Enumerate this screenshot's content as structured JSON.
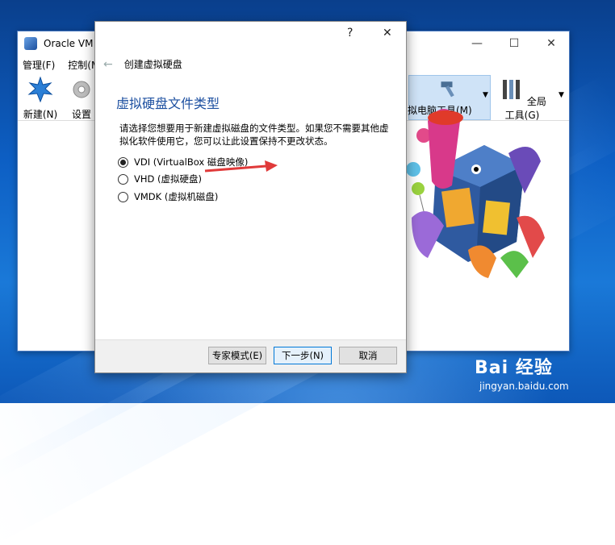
{
  "main_window": {
    "title": "Oracle VM V",
    "controls": {
      "minimize": "—",
      "maximize": "☐",
      "close": "✕"
    },
    "menu": [
      "管理(F)",
      "控制(M"
    ],
    "toolbar": {
      "new_label": "新建(N)",
      "settings_label": "设置",
      "machine_tools_label": "拟电脑工具(M)",
      "global_tools_label": "全局工具(G)"
    }
  },
  "dialog": {
    "help": "?",
    "close": "✕",
    "back": "←",
    "window_title": "创建虚拟硬盘",
    "section_title": "虚拟硬盘文件类型",
    "description": "请选择您想要用于新建虚拟磁盘的文件类型。如果您不需要其他虚拟化软件使用它，您可以让此设置保持不更改状态。",
    "options": [
      {
        "label": "VDI (VirtualBox 磁盘映像)",
        "checked": true
      },
      {
        "label": "VHD (虚拟硬盘)",
        "checked": false
      },
      {
        "label": "VMDK (虚拟机磁盘)",
        "checked": false
      }
    ],
    "buttons": {
      "expert": "专家模式(E)",
      "next": "下一步(N)",
      "cancel": "取消"
    }
  },
  "watermark": {
    "brand": "Bai 经验",
    "url": "jingyan.baidu.com"
  },
  "colors": {
    "annotation_arrow": "#e03a3a",
    "section_title": "#1c4fa0",
    "desktop": "#0d5fc4"
  }
}
